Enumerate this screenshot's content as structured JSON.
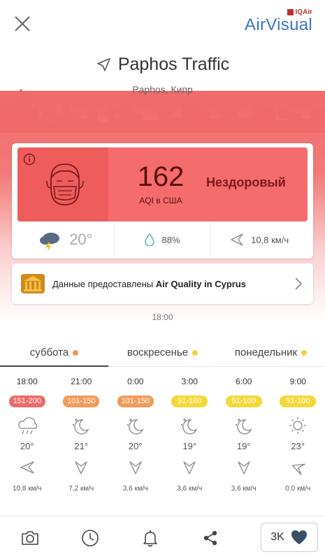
{
  "brand": {
    "iq": "IQAir",
    "name": "AirVisual"
  },
  "location": {
    "title": "Paphos Traffic",
    "subtitle": "Paphos, Кипр"
  },
  "aqi": {
    "value": "162",
    "label": "AQI в США",
    "status": "Нездоровый"
  },
  "weather": {
    "temp": "20°",
    "humidity": "88%",
    "wind": "10,8 км/ч"
  },
  "provider": {
    "prefix": "Данные предоставлены ",
    "name": "Air Quality in Cyprus"
  },
  "updated_time": "18:00",
  "tabs": [
    {
      "label": "суббота",
      "dot_color": "#f29a4a",
      "active": true
    },
    {
      "label": "воскресенье",
      "dot_color": "#f2d33a",
      "active": false
    },
    {
      "label": "понедельник",
      "dot_color": "#f2d33a",
      "active": false
    }
  ],
  "forecast": [
    {
      "time": "18:00",
      "aqi_range": "151-200",
      "aqi_color": "#ef6b6b",
      "icon": "cloud-rain-icon",
      "temp": "20°",
      "wind": "10,8 км/ч"
    },
    {
      "time": "21:00",
      "aqi_range": "101-150",
      "aqi_color": "#f39a5a",
      "icon": "moon-stars-icon",
      "temp": "21°",
      "wind": "7,2 км/ч"
    },
    {
      "time": "0:00",
      "aqi_range": "101-150",
      "aqi_color": "#f39a5a",
      "icon": "moon-stars-icon",
      "temp": "20°",
      "wind": "3,6 км/ч"
    },
    {
      "time": "3:00",
      "aqi_range": "51-100",
      "aqi_color": "#f4d83a",
      "icon": "moon-stars-icon",
      "temp": "19°",
      "wind": "3,6 км/ч"
    },
    {
      "time": "6:00",
      "aqi_range": "51-100",
      "aqi_color": "#f4d83a",
      "icon": "moon-stars-icon",
      "temp": "19°",
      "wind": "3,6 км/ч"
    },
    {
      "time": "9:00",
      "aqi_range": "51-100",
      "aqi_color": "#f4d83a",
      "icon": "sun-icon",
      "temp": "23°",
      "wind": "0.0 км/ч"
    }
  ],
  "likes": {
    "count": "3K"
  },
  "colors": {
    "unhealthy": "#f46c6c",
    "accent_blue": "#3b74c4"
  }
}
